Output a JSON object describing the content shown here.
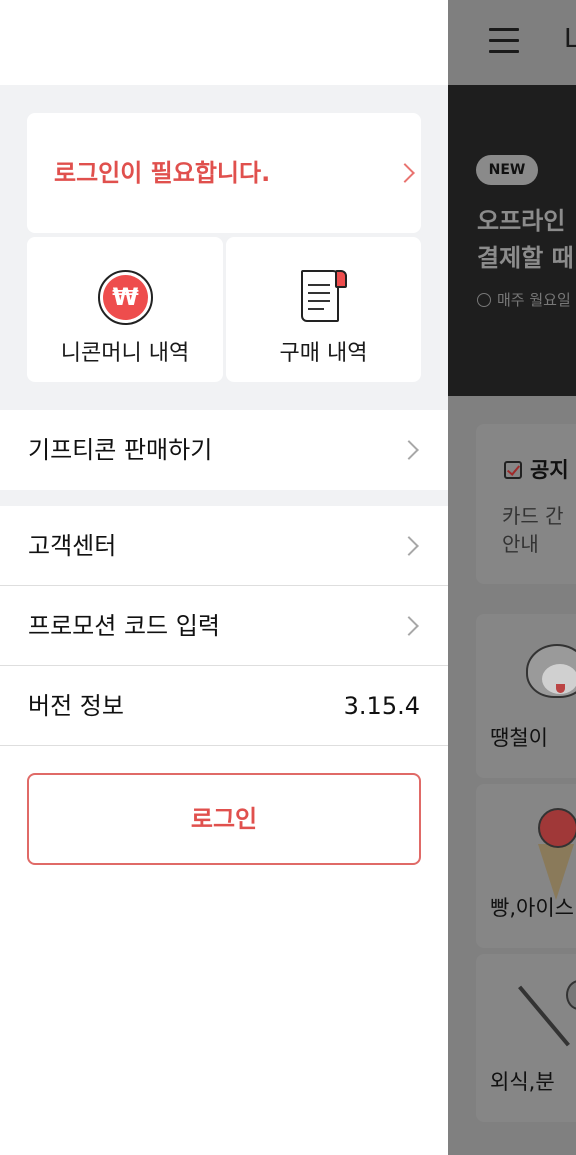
{
  "background_app": {
    "logo_text": "L",
    "banner": {
      "badge": "NEW",
      "title_line1": "오프라인",
      "title_line2": "결제할 때",
      "subtitle": "매주 월요일"
    },
    "notice": {
      "title": "공지",
      "body_line1": "카드 간",
      "body_line2": "안내"
    },
    "categories": [
      {
        "label": "땡철이",
        "icon": "dog-icon"
      },
      {
        "label": "빵,아이스",
        "icon": "ice-cream-icon"
      },
      {
        "label": "외식,분",
        "icon": "fork-spoon-icon"
      }
    ]
  },
  "drawer": {
    "login_prompt": "로그인이 필요합니다.",
    "tiles": [
      {
        "label": "니콘머니 내역",
        "icon": "won-coin-icon",
        "icon_glyph": "₩"
      },
      {
        "label": "구매 내역",
        "icon": "receipt-icon"
      }
    ],
    "menu": [
      {
        "label": "기프티콘 판매하기"
      },
      {
        "label": "고객센터"
      },
      {
        "label": "프로모션 코드 입력"
      },
      {
        "label": "버전 정보",
        "value": "3.15.4"
      }
    ],
    "login_button": "로그인"
  },
  "colors": {
    "accent": "#e0504d",
    "section_background": "#f1f2f4",
    "overlay": "#808080"
  }
}
